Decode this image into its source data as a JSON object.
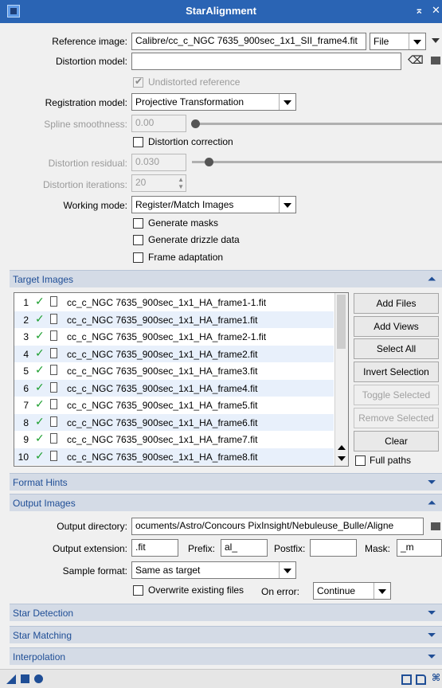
{
  "window": {
    "title": "StarAlignment",
    "title_buttons": [
      "⌅",
      "✕"
    ]
  },
  "reference": {
    "label": "Reference image:",
    "value": "Calibre/cc_c_NGC 7635_900sec_1x1_SII_frame4.fit",
    "mode": "File"
  },
  "distortion_model": {
    "label": "Distortion model:",
    "value": ""
  },
  "undistorted_reference": {
    "label": "Undistorted reference",
    "checked": true
  },
  "registration_model": {
    "label": "Registration model:",
    "value": "Projective Transformation"
  },
  "spline_smoothness": {
    "label": "Spline smoothness:",
    "value": "0.00"
  },
  "distortion_correction": {
    "label": "Distortion correction",
    "checked": false
  },
  "distortion_residual": {
    "label": "Distortion residual:",
    "value": "0.030"
  },
  "distortion_iterations": {
    "label": "Distortion iterations:",
    "value": "20"
  },
  "working_mode": {
    "label": "Working mode:",
    "value": "Register/Match Images"
  },
  "options": [
    {
      "label": "Generate masks",
      "checked": false
    },
    {
      "label": "Generate drizzle data",
      "checked": false
    },
    {
      "label": "Frame adaptation",
      "checked": false
    }
  ],
  "target_images": {
    "title": "Target Images",
    "rows": [
      {
        "n": "1",
        "file": "cc_c_NGC 7635_900sec_1x1_HA_frame1-1.fit"
      },
      {
        "n": "2",
        "file": "cc_c_NGC 7635_900sec_1x1_HA_frame1.fit"
      },
      {
        "n": "3",
        "file": "cc_c_NGC 7635_900sec_1x1_HA_frame2-1.fit"
      },
      {
        "n": "4",
        "file": "cc_c_NGC 7635_900sec_1x1_HA_frame2.fit"
      },
      {
        "n": "5",
        "file": "cc_c_NGC 7635_900sec_1x1_HA_frame3.fit"
      },
      {
        "n": "6",
        "file": "cc_c_NGC 7635_900sec_1x1_HA_frame4.fit"
      },
      {
        "n": "7",
        "file": "cc_c_NGC 7635_900sec_1x1_HA_frame5.fit"
      },
      {
        "n": "8",
        "file": "cc_c_NGC 7635_900sec_1x1_HA_frame6.fit"
      },
      {
        "n": "9",
        "file": "cc_c_NGC 7635_900sec_1x1_HA_frame7.fit"
      },
      {
        "n": "10",
        "file": "cc_c_NGC 7635_900sec_1x1_HA_frame8.fit"
      }
    ],
    "buttons": {
      "add_files": "Add Files",
      "add_views": "Add Views",
      "select_all": "Select All",
      "invert_selection": "Invert Selection",
      "toggle_selected": "Toggle Selected",
      "remove_selected": "Remove Selected",
      "clear": "Clear"
    },
    "full_paths": "Full paths"
  },
  "sections": {
    "format_hints": "Format Hints",
    "output_images": "Output Images",
    "star_detection": "Star Detection",
    "star_matching": "Star Matching",
    "interpolation": "Interpolation"
  },
  "output": {
    "directory_label": "Output directory:",
    "directory": "ocuments/Astro/Concours PixInsight/Nebuleuse_Bulle/Aligne",
    "extension_label": "Output extension:",
    "extension": ".fit",
    "prefix_label": "Prefix:",
    "prefix": "al_",
    "postfix_label": "Postfix:",
    "postfix": "",
    "mask_label": "Mask:",
    "mask": "_m",
    "sample_format_label": "Sample format:",
    "sample_format": "Same as target",
    "overwrite_label": "Overwrite existing files",
    "on_error_label": "On error:",
    "on_error": "Continue"
  },
  "colors": {
    "title_bar": "#2a64b4",
    "section_header": "#d4dbe6",
    "section_text": "#1f4e96",
    "check_mark": "#1a9e2d"
  }
}
